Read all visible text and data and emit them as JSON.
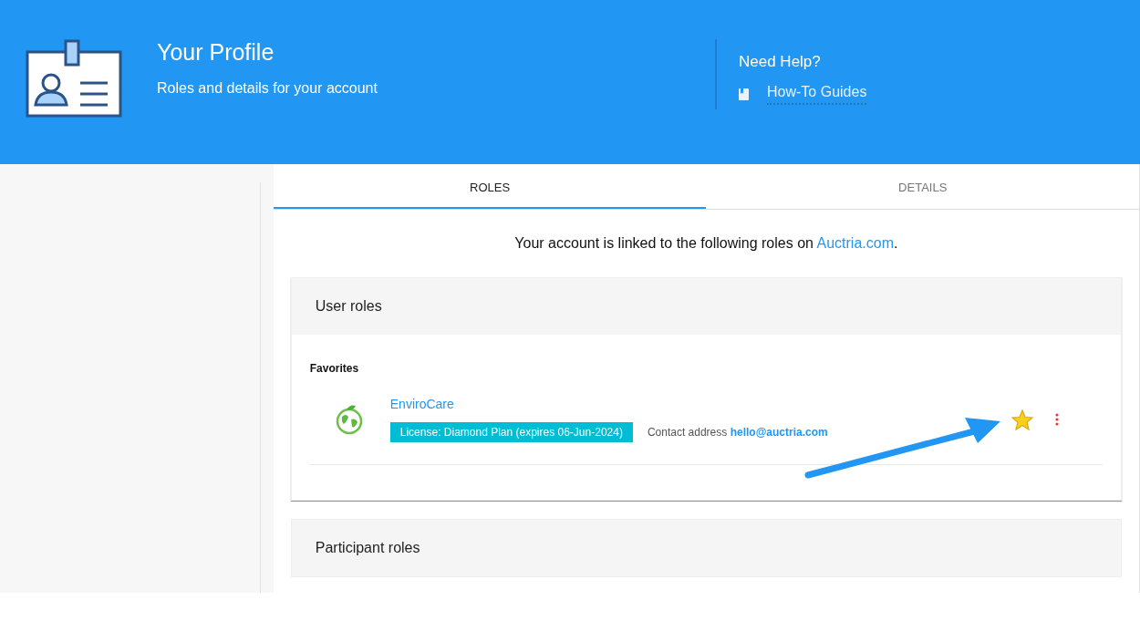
{
  "header": {
    "title": "Your Profile",
    "subtitle": "Roles and details for your account",
    "help": {
      "title": "Need Help?",
      "link": "How-To Guides"
    }
  },
  "tabs": [
    {
      "label": "ROLES",
      "selected": true
    },
    {
      "label": "DETAILS",
      "selected": false
    }
  ],
  "intro": {
    "text": "Your account is linked to the following roles on ",
    "link": "Auctria.com",
    "end": "."
  },
  "sections": [
    {
      "title": "User roles",
      "groups": [
        {
          "title": "Favorites",
          "roles": [
            {
              "name": "EnviroCare",
              "license": "License: Diamond Plan (expires 06-Jun-2024)",
              "contact_label": "Contact address",
              "contact": "hello@auctria.com",
              "favorite": true
            }
          ]
        }
      ]
    },
    {
      "title": "Participant roles"
    }
  ]
}
